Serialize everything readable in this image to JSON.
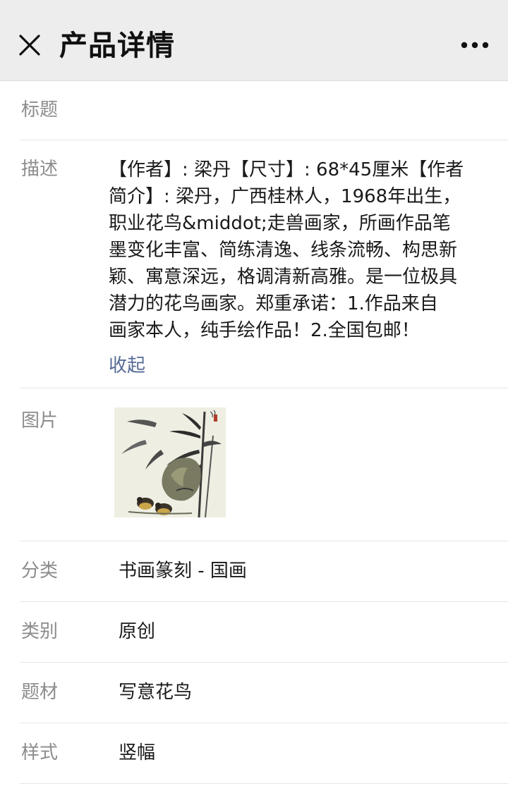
{
  "header": {
    "title": "产品详情"
  },
  "fields": {
    "title_label": "标题",
    "title_value": "",
    "description_label": "描述",
    "description_lines": [
      "【作者】: 梁丹【尺寸】: 68*45厘米【作者",
      "简介】: 梁丹，广西桂林人，1968年出生，",
      "职业花鸟&middot;走兽画家，所画作品笔",
      "墨变化丰富、简练清逸、线条流畅、构思新",
      "颖、寓意深远，格调清新高雅。是一位极具",
      "潜力的花鸟画家。郑重承诺：1.作品来自",
      "画家本人，纯手绘作品！2.全国包邮！"
    ],
    "collapse_label": "收起",
    "image_label": "图片",
    "image_icon": "bamboo-bird-painting-thumbnail",
    "category_label": "分类",
    "category_value": "书画篆刻 - 国画",
    "type_label": "类别",
    "type_value": "原创",
    "subject_label": "题材",
    "subject_value": "写意花鸟",
    "style_label": "样式",
    "style_value": "竖幅"
  },
  "icons": {
    "close": "close-icon",
    "more": "more-icon"
  },
  "colors": {
    "nav_background": "#ededed",
    "label_gray": "#8c8c8c",
    "link_blue": "#576b95",
    "divider": "#e6e6e6"
  }
}
